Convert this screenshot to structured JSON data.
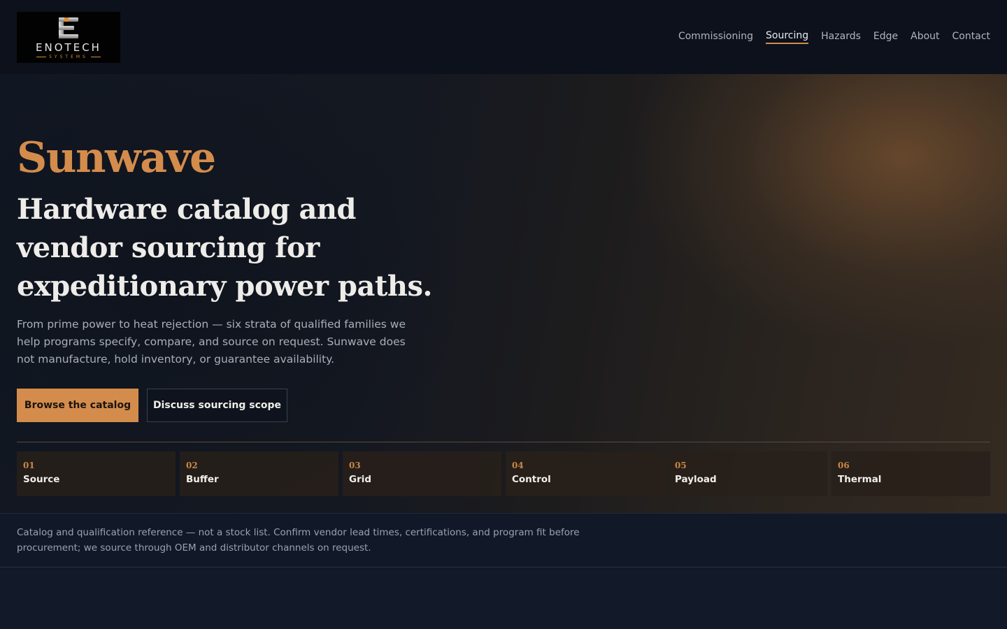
{
  "header": {
    "logo": {
      "wordmark": "ENOTECH",
      "sub": "SYSTEMS"
    },
    "nav": [
      {
        "label": "Commissioning",
        "active": false
      },
      {
        "label": "Sourcing",
        "active": true
      },
      {
        "label": "Hazards",
        "active": false
      },
      {
        "label": "Edge",
        "active": false
      },
      {
        "label": "About",
        "active": false
      },
      {
        "label": "Contact",
        "active": false
      }
    ]
  },
  "hero": {
    "brand": "Sunwave",
    "headline": "Hardware catalog and vendor sourcing for expeditionary power paths.",
    "lede": "From prime power to heat rejection — six strata of qualified families we help programs specify, compare, and source on request. Sunwave does not manufacture, hold inventory, or guarantee availability.",
    "primary_cta": "Browse the catalog",
    "secondary_cta": "Discuss sourcing scope",
    "strata": [
      {
        "num": "01",
        "label": "Source"
      },
      {
        "num": "02",
        "label": "Buffer"
      },
      {
        "num": "03",
        "label": "Grid"
      },
      {
        "num": "04",
        "label": "Control"
      },
      {
        "num": "05",
        "label": "Payload"
      },
      {
        "num": "06",
        "label": "Thermal"
      }
    ]
  },
  "notice": {
    "text": "Catalog and qualification reference — not a stock list. Confirm vendor lead times, certifications, and program fit before procurement; we source through OEM and distributor channels on request."
  },
  "colors": {
    "accent": "#d48c4c",
    "background": "#0f1521",
    "header": "#0c111b"
  }
}
